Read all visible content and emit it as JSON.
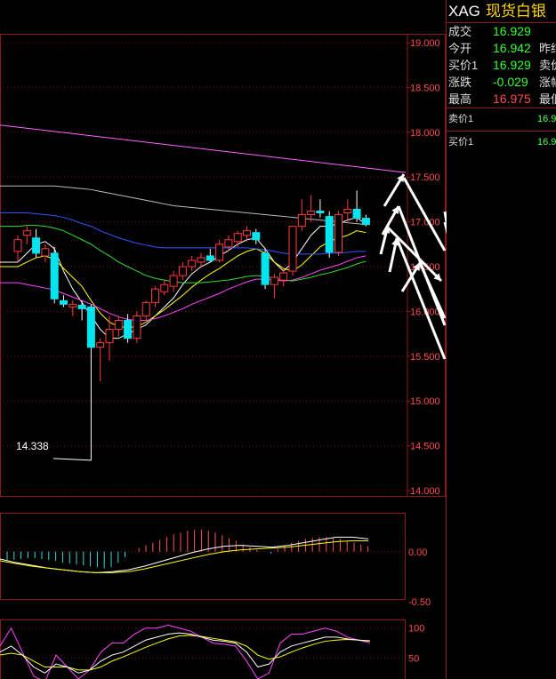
{
  "quote": {
    "symbol": "XAG",
    "name": "现货白银",
    "rows": [
      {
        "label": "成交",
        "value": "16.929",
        "color": "#33ff33",
        "label2": ""
      },
      {
        "label": "今开",
        "value": "16.942",
        "color": "#33ff33",
        "label2": "昨结"
      },
      {
        "label": "买价1",
        "value": "16.929",
        "color": "#33ff33",
        "label2": "卖价"
      },
      {
        "label": "涨跌",
        "value": "-0.029",
        "color": "#33ff33",
        "label2": "涨幅"
      },
      {
        "label": "最高",
        "value": "16.975",
        "color": "#ff4d4d",
        "label2": "最低"
      }
    ],
    "orderbook": [
      {
        "label": "卖价1",
        "value": "16.9"
      },
      {
        "label": "买价1",
        "value": "16.9"
      }
    ]
  },
  "chart_data": [
    {
      "type": "candlestick",
      "yticks": [
        "19.000",
        "18.500",
        "18.000",
        "17.500",
        "17.000",
        "16.500",
        "16.000",
        "15.500",
        "15.000",
        "14.500",
        "14.000"
      ],
      "ylim": [
        14.0,
        19.0
      ],
      "low_annotation": "14.338",
      "up_color": "#ff3b3b",
      "down_color": "#00e5ee",
      "candles": [
        {
          "o": 16.67,
          "h": 16.85,
          "l": 16.55,
          "c": 16.8
        },
        {
          "o": 16.85,
          "h": 16.95,
          "l": 16.75,
          "c": 16.9
        },
        {
          "o": 16.82,
          "h": 16.92,
          "l": 16.6,
          "c": 16.65
        },
        {
          "o": 16.62,
          "h": 16.75,
          "l": 16.55,
          "c": 16.7
        },
        {
          "o": 16.65,
          "h": 16.72,
          "l": 16.09,
          "c": 16.14
        },
        {
          "o": 16.12,
          "h": 16.18,
          "l": 16.05,
          "c": 16.08
        },
        {
          "o": 16.05,
          "h": 16.12,
          "l": 15.95,
          "c": 16.08
        },
        {
          "o": 16.07,
          "h": 16.12,
          "l": 15.9,
          "c": 16.03
        },
        {
          "o": 16.05,
          "h": 16.08,
          "l": 14.338,
          "c": 15.6
        },
        {
          "o": 15.6,
          "h": 15.7,
          "l": 15.22,
          "c": 15.65
        },
        {
          "o": 15.65,
          "h": 15.95,
          "l": 15.45,
          "c": 15.8
        },
        {
          "o": 15.8,
          "h": 15.95,
          "l": 15.72,
          "c": 15.9
        },
        {
          "o": 15.9,
          "h": 15.97,
          "l": 15.65,
          "c": 15.7
        },
        {
          "o": 15.7,
          "h": 16.0,
          "l": 15.65,
          "c": 15.95
        },
        {
          "o": 15.95,
          "h": 16.12,
          "l": 15.9,
          "c": 16.1
        },
        {
          "o": 16.1,
          "h": 16.28,
          "l": 16.05,
          "c": 16.25
        },
        {
          "o": 16.22,
          "h": 16.35,
          "l": 16.18,
          "c": 16.3
        },
        {
          "o": 16.28,
          "h": 16.45,
          "l": 16.22,
          "c": 16.4
        },
        {
          "o": 16.4,
          "h": 16.55,
          "l": 16.35,
          "c": 16.5
        },
        {
          "o": 16.5,
          "h": 16.62,
          "l": 16.45,
          "c": 16.57
        },
        {
          "o": 16.55,
          "h": 16.65,
          "l": 16.5,
          "c": 16.6
        },
        {
          "o": 16.62,
          "h": 16.7,
          "l": 16.55,
          "c": 16.57
        },
        {
          "o": 16.57,
          "h": 16.8,
          "l": 16.55,
          "c": 16.75
        },
        {
          "o": 16.72,
          "h": 16.85,
          "l": 16.68,
          "c": 16.8
        },
        {
          "o": 16.78,
          "h": 16.9,
          "l": 16.72,
          "c": 16.87
        },
        {
          "o": 16.85,
          "h": 16.95,
          "l": 16.78,
          "c": 16.9
        },
        {
          "o": 16.88,
          "h": 16.92,
          "l": 16.75,
          "c": 16.8
        },
        {
          "o": 16.65,
          "h": 16.7,
          "l": 16.25,
          "c": 16.3
        },
        {
          "o": 16.3,
          "h": 16.42,
          "l": 16.15,
          "c": 16.38
        },
        {
          "o": 16.35,
          "h": 16.48,
          "l": 16.28,
          "c": 16.43
        },
        {
          "o": 16.45,
          "h": 16.95,
          "l": 16.4,
          "c": 16.95
        },
        {
          "o": 16.95,
          "h": 17.25,
          "l": 16.9,
          "c": 17.08
        },
        {
          "o": 17.08,
          "h": 17.3,
          "l": 17.0,
          "c": 17.12
        },
        {
          "o": 17.12,
          "h": 17.25,
          "l": 17.05,
          "c": 17.1
        },
        {
          "o": 17.06,
          "h": 17.12,
          "l": 16.6,
          "c": 16.66
        },
        {
          "o": 16.66,
          "h": 17.12,
          "l": 16.62,
          "c": 17.08
        },
        {
          "o": 17.1,
          "h": 17.25,
          "l": 17.0,
          "c": 17.14
        },
        {
          "o": 17.14,
          "h": 17.35,
          "l": 17.0,
          "c": 17.04
        },
        {
          "o": 17.04,
          "h": 17.08,
          "l": 16.95,
          "c": 16.97
        }
      ],
      "ma_lines": [
        {
          "color": "#ffffff",
          "values": [
            16.55,
            16.65,
            16.75,
            16.78,
            16.7,
            16.45,
            16.25,
            16.1,
            15.95,
            15.8,
            15.7,
            15.7,
            15.75,
            15.8,
            15.85,
            15.95,
            16.05,
            16.15,
            16.3,
            16.42,
            16.5,
            16.55,
            16.62,
            16.68,
            16.75,
            16.8,
            16.82,
            16.7,
            16.55,
            16.45,
            16.55,
            16.7,
            16.85,
            16.95,
            16.95,
            16.98,
            17.02,
            17.05,
            16.97
          ]
        },
        {
          "color": "#ffff00",
          "values": [
            16.5,
            16.55,
            16.6,
            16.62,
            16.58,
            16.48,
            16.38,
            16.28,
            16.12,
            15.98,
            15.88,
            15.83,
            15.82,
            15.83,
            15.88,
            15.95,
            16.02,
            16.1,
            16.18,
            16.27,
            16.35,
            16.42,
            16.48,
            16.55,
            16.62,
            16.67,
            16.7,
            16.65,
            16.55,
            16.48,
            16.45,
            16.52,
            16.62,
            16.72,
            16.78,
            16.82,
            16.85,
            16.9,
            16.88
          ]
        },
        {
          "color": "#ff44ff",
          "values": [
            16.32,
            16.3,
            16.28,
            16.26,
            16.24,
            16.2,
            16.16,
            16.12,
            16.08,
            16.03,
            15.98,
            15.94,
            15.91,
            15.9,
            15.9,
            15.92,
            15.95,
            15.99,
            16.03,
            16.08,
            16.12,
            16.16,
            16.2,
            16.25,
            16.29,
            16.33,
            16.36,
            16.36,
            16.35,
            16.34,
            16.35,
            16.38,
            16.42,
            16.46,
            16.49,
            16.52,
            16.56,
            16.6,
            16.62
          ]
        },
        {
          "color": "#33dd33",
          "values": [
            16.95,
            16.96,
            16.96,
            16.95,
            16.93,
            16.9,
            16.85,
            16.8,
            16.75,
            16.68,
            16.62,
            16.55,
            16.5,
            16.45,
            16.4,
            16.37,
            16.35,
            16.33,
            16.32,
            16.32,
            16.32,
            16.33,
            16.34,
            16.35,
            16.37,
            16.39,
            16.4,
            16.39,
            16.37,
            16.35,
            16.34,
            16.36,
            16.38,
            16.41,
            16.43,
            16.46,
            16.49,
            16.53,
            16.56
          ]
        },
        {
          "color": "#3355ff",
          "values": [
            17.1,
            17.1,
            17.09,
            17.08,
            17.07,
            17.05,
            17.02,
            16.98,
            16.95,
            16.9,
            16.86,
            16.82,
            16.79,
            16.76,
            16.74,
            16.72,
            16.71,
            16.71,
            16.71,
            16.71,
            16.71,
            16.71,
            16.71,
            16.71,
            16.71,
            16.71,
            16.7,
            16.69,
            16.67,
            16.65,
            16.64,
            16.64,
            16.64,
            16.64,
            16.65,
            16.65,
            16.66,
            16.67,
            16.67
          ]
        },
        {
          "color": "#bbbbbb",
          "values": [
            17.4,
            17.4,
            17.4,
            17.4,
            17.4,
            17.39,
            17.38,
            17.37,
            17.36,
            17.34,
            17.32,
            17.3,
            17.28,
            17.26,
            17.24,
            17.22,
            17.2,
            17.18,
            17.17,
            17.16,
            17.15,
            17.14,
            17.13,
            17.12,
            17.11,
            17.1,
            17.09,
            17.08,
            17.07,
            17.06,
            17.05,
            17.04,
            17.03,
            17.02,
            17.01,
            17.0,
            16.99,
            16.98,
            16.97
          ]
        }
      ],
      "long_ma": {
        "color": "#ff66ff",
        "start": 18.08,
        "end": 17.55
      },
      "macd": {
        "ytick_labels": [
          "0.00",
          "-0.50"
        ],
        "hist": [
          -0.1,
          -0.09,
          -0.08,
          -0.07,
          -0.07,
          -0.08,
          -0.09,
          -0.1,
          -0.12,
          -0.13,
          -0.14,
          -0.15,
          -0.16,
          -0.17,
          -0.18,
          -0.17,
          -0.12,
          -0.06,
          0.0,
          0.04,
          0.07,
          0.1,
          0.13,
          0.16,
          0.19,
          0.21,
          0.23,
          0.24,
          0.24,
          0.23,
          0.21,
          0.18,
          0.15,
          0.12,
          0.08,
          0.05,
          0.02,
          0.0,
          -0.02,
          0.03,
          0.07,
          0.1,
          0.12,
          0.14,
          0.15,
          0.16,
          0.16,
          0.15,
          0.14,
          0.12,
          0.1,
          0.08,
          0.06
        ],
        "dif": [
          -0.08,
          -0.12,
          -0.15,
          -0.18,
          -0.2,
          -0.22,
          -0.23,
          -0.22,
          -0.2,
          -0.16,
          -0.11,
          -0.06,
          -0.01,
          0.03,
          0.06,
          0.07,
          0.06,
          0.05,
          0.07,
          0.1,
          0.13,
          0.16,
          0.16,
          0.14
        ],
        "dea": [
          -0.1,
          -0.13,
          -0.16,
          -0.18,
          -0.2,
          -0.22,
          -0.23,
          -0.23,
          -0.22,
          -0.19,
          -0.15,
          -0.11,
          -0.07,
          -0.03,
          0.0,
          0.02,
          0.03,
          0.04,
          0.05,
          0.07,
          0.09,
          0.11,
          0.12,
          0.12
        ],
        "ylim": [
          -0.5,
          0.3
        ]
      },
      "kdj": {
        "ytick_labels": [
          "100",
          "50"
        ],
        "ylim": [
          15,
          110
        ],
        "k": [
          60,
          70,
          55,
          35,
          25,
          40,
          35,
          25,
          30,
          45,
          55,
          60,
          70,
          80,
          85,
          90,
          92,
          90,
          85,
          80,
          78,
          75,
          60,
          35,
          40,
          60,
          70,
          75,
          80,
          85,
          85,
          82,
          80,
          78
        ],
        "d": [
          55,
          58,
          55,
          45,
          35,
          35,
          35,
          30,
          30,
          35,
          45,
          52,
          60,
          68,
          75,
          82,
          87,
          88,
          86,
          83,
          80,
          77,
          70,
          55,
          48,
          52,
          60,
          67,
          73,
          78,
          80,
          81,
          80,
          79
        ],
        "j": [
          70,
          100,
          60,
          20,
          10,
          55,
          35,
          15,
          30,
          60,
          75,
          75,
          90,
          100,
          100,
          105,
          100,
          95,
          85,
          75,
          73,
          70,
          45,
          15,
          25,
          75,
          90,
          90,
          95,
          100,
          95,
          85,
          80,
          75
        ]
      }
    }
  ]
}
